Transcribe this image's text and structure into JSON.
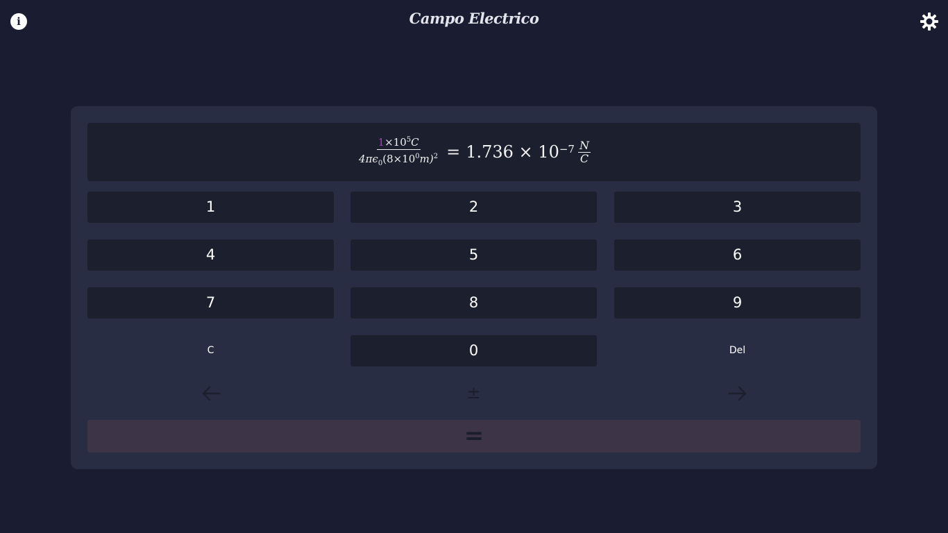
{
  "header": {
    "title": "Campo Electrico",
    "info_icon": "info-icon",
    "theme_icon": "gear-icon"
  },
  "display": {
    "numerator": {
      "highlighted_digit": "1",
      "times": "×10",
      "exponent": "5",
      "unit": "C"
    },
    "denominator": {
      "prefix": "4πϵ",
      "prefix_sub": "0",
      "open": "(8×10",
      "exponent": "0",
      "unit": "m)",
      "power": "2"
    },
    "result": {
      "equals": "=",
      "mantissa": "1.736 × 10",
      "exponent": "−7",
      "unit_numerator": "N",
      "unit_denominator": "C"
    }
  },
  "keypad": {
    "row1": [
      "1",
      "2",
      "3"
    ],
    "row2": [
      "4",
      "5",
      "6"
    ],
    "row3": [
      "7",
      "8",
      "9"
    ],
    "clear": "C",
    "zero": "0",
    "delete": "Del",
    "left_arrow_icon": "arrow-left-icon",
    "plus_minus": "±",
    "right_arrow_icon": "arrow-right-icon",
    "equals": "="
  },
  "colors": {
    "background": "#1a1d31",
    "panel": "#292d44",
    "key": "#1c1f2d",
    "highlight": "#a640c0",
    "equals_bar": "#3e3447"
  }
}
